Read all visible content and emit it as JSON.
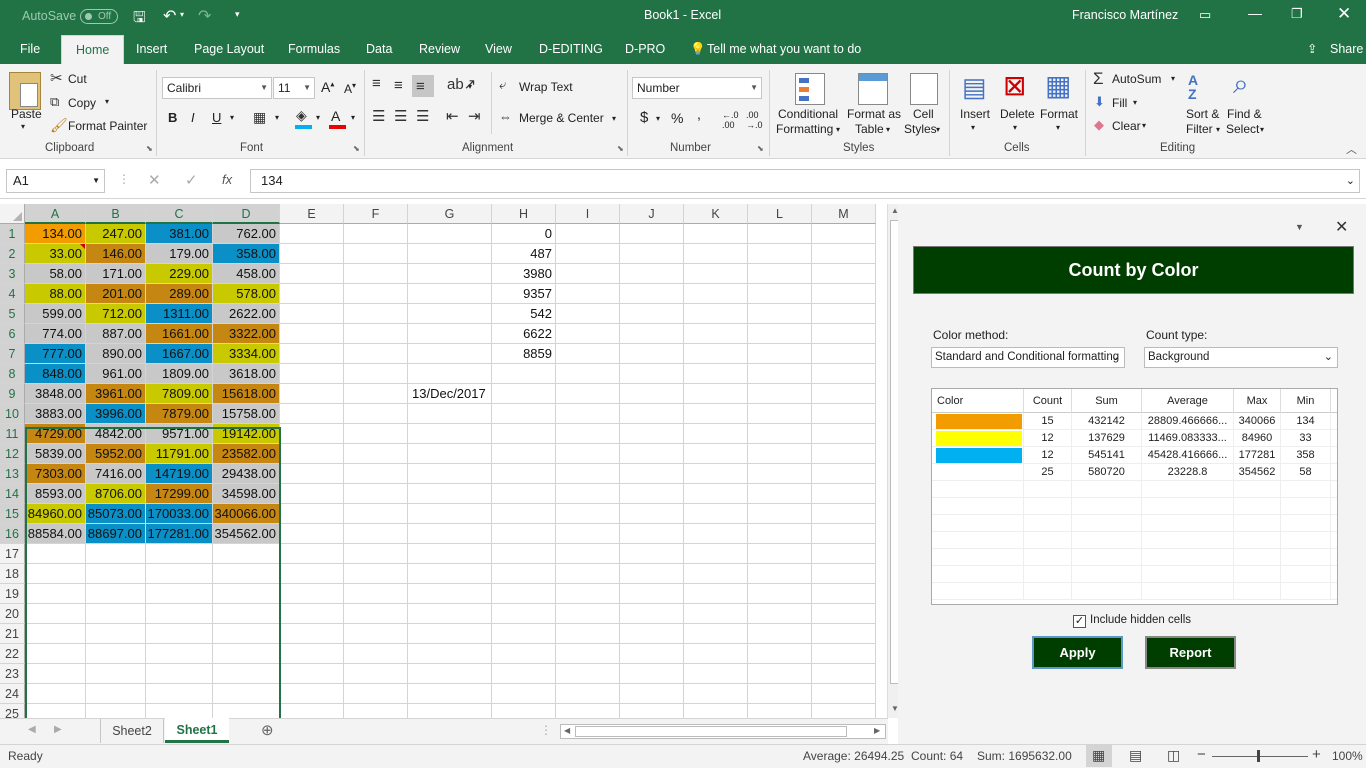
{
  "titlebar": {
    "autosave_label": "AutoSave",
    "autosave_state": "Off",
    "title": "Book1  -  Excel",
    "user": "Francisco Martínez"
  },
  "tabs": [
    "File",
    "Home",
    "Insert",
    "Page Layout",
    "Formulas",
    "Data",
    "Review",
    "View",
    "D-EDITING",
    "D-PRO"
  ],
  "tell_me": "Tell me what you want to do",
  "share": "Share",
  "ribbon": {
    "clipboard": {
      "paste": "Paste",
      "cut": "Cut",
      "copy": "Copy",
      "format_painter": "Format Painter",
      "label": "Clipboard"
    },
    "font": {
      "name": "Calibri",
      "size": "11",
      "bold": "B",
      "italic": "I",
      "underline": "U",
      "label": "Font"
    },
    "alignment": {
      "wrap_text": "Wrap Text",
      "merge_center": "Merge & Center",
      "label": "Alignment"
    },
    "number": {
      "format": "Number",
      "currency": "$",
      "percent": "%",
      "comma": ",",
      "label": "Number"
    },
    "styles": {
      "conditional": "Conditional",
      "conditional2": "Formatting",
      "format_as": "Format as",
      "format_as2": "Table",
      "cell": "Cell",
      "cell2": "Styles",
      "label": "Styles"
    },
    "cells": {
      "insert": "Insert",
      "delete": "Delete",
      "format": "Format",
      "label": "Cells"
    },
    "editing": {
      "autosum": "AutoSum",
      "fill": "Fill",
      "clear": "Clear",
      "sort": "Sort &",
      "sort2": "Filter",
      "find": "Find &",
      "find2": "Select",
      "label": "Editing"
    }
  },
  "formula_bar": {
    "name_box": "A1",
    "fx": "fx",
    "value": "134"
  },
  "columns": [
    "A",
    "B",
    "C",
    "D",
    "E",
    "F",
    "G",
    "H",
    "I",
    "J",
    "K",
    "L",
    "M"
  ],
  "rows": [
    "1",
    "2",
    "3",
    "4",
    "5",
    "6",
    "7",
    "8",
    "9",
    "10",
    "11",
    "12",
    "13",
    "14",
    "15",
    "16",
    "17",
    "18",
    "19",
    "20",
    "21",
    "22",
    "23",
    "24",
    "25"
  ],
  "colors": {
    "orange": "#f29c00",
    "yellow": "#c9c900",
    "blue": "#0a8fc6",
    "grey": "#c8c8c8",
    "brown": "#c68612",
    "green": "#217346",
    "panel_dark": "#003e00"
  },
  "table_cells": [
    [
      "134.00",
      "247.00",
      "381.00",
      "762.00"
    ],
    [
      "33.00",
      "146.00",
      "179.00",
      "358.00"
    ],
    [
      "58.00",
      "171.00",
      "229.00",
      "458.00"
    ],
    [
      "88.00",
      "201.00",
      "289.00",
      "578.00"
    ],
    [
      "599.00",
      "712.00",
      "1311.00",
      "2622.00"
    ],
    [
      "774.00",
      "887.00",
      "1661.00",
      "3322.00"
    ],
    [
      "777.00",
      "890.00",
      "1667.00",
      "3334.00"
    ],
    [
      "848.00",
      "961.00",
      "1809.00",
      "3618.00"
    ],
    [
      "3848.00",
      "3961.00",
      "7809.00",
      "15618.00"
    ],
    [
      "3883.00",
      "3996.00",
      "7879.00",
      "15758.00"
    ],
    [
      "4729.00",
      "4842.00",
      "9571.00",
      "19142.00"
    ],
    [
      "5839.00",
      "5952.00",
      "11791.00",
      "23582.00"
    ],
    [
      "7303.00",
      "7416.00",
      "14719.00",
      "29438.00"
    ],
    [
      "8593.00",
      "8706.00",
      "17299.00",
      "34598.00"
    ],
    [
      "84960.00",
      "85073.00",
      "170033.00",
      "340066.00"
    ],
    [
      "88584.00",
      "88697.00",
      "177281.00",
      "354562.00"
    ]
  ],
  "table_fills": [
    [
      "orange",
      "yellow",
      "blue",
      "grey"
    ],
    [
      "yellow",
      "brown",
      "grey",
      "blue"
    ],
    [
      "grey",
      "grey",
      "yellow",
      "grey"
    ],
    [
      "yellow",
      "brown",
      "brown",
      "yellow"
    ],
    [
      "grey",
      "yellow",
      "blue",
      "grey"
    ],
    [
      "grey",
      "grey",
      "brown",
      "brown"
    ],
    [
      "blue",
      "grey",
      "blue",
      "yellow"
    ],
    [
      "blue",
      "grey",
      "grey",
      "grey"
    ],
    [
      "grey",
      "brown",
      "yellow",
      "brown"
    ],
    [
      "grey",
      "blue",
      "brown",
      "grey"
    ],
    [
      "brown",
      "grey",
      "grey",
      "yellow"
    ],
    [
      "grey",
      "brown",
      "yellow",
      "brown"
    ],
    [
      "brown",
      "grey",
      "blue",
      "grey"
    ],
    [
      "grey",
      "yellow",
      "brown",
      "grey"
    ],
    [
      "yellow",
      "blue",
      "blue",
      "brown"
    ],
    [
      "grey",
      "blue",
      "blue",
      "grey"
    ]
  ],
  "h_column": [
    "0",
    "487",
    "3980",
    "9357",
    "542",
    "6622",
    "8859"
  ],
  "g9": "13/Dec/2017",
  "sheets": [
    "Sheet2",
    "Sheet1"
  ],
  "active_sheet": "Sheet1",
  "status": {
    "ready": "Ready",
    "average": "Average: 26494.25",
    "count": "Count: 64",
    "sum": "Sum: 1695632.00",
    "zoom": "100%"
  },
  "panel": {
    "title": "Count by Color",
    "color_method_label": "Color method:",
    "color_method_value": "Standard and Conditional formatting",
    "count_type_label": "Count type:",
    "count_type_value": "Background",
    "table_headers": [
      "Color",
      "Count",
      "Sum",
      "Average",
      "Max",
      "Min"
    ],
    "table_rows": [
      {
        "swatch": "#f29c00",
        "count": "15",
        "sum": "432142",
        "average": "28809.466666...",
        "max": "340066",
        "min": "134"
      },
      {
        "swatch": "#ffff00",
        "count": "12",
        "sum": "137629",
        "average": "11469.083333...",
        "max": "84960",
        "min": "33"
      },
      {
        "swatch": "#00b0f0",
        "count": "12",
        "sum": "545141",
        "average": "45428.416666...",
        "max": "177281",
        "min": "358"
      },
      {
        "swatch": "#ffffff",
        "count": "25",
        "sum": "580720",
        "average": "23228.8",
        "max": "354562",
        "min": "58"
      }
    ],
    "include_hidden": "Include hidden cells",
    "apply": "Apply",
    "report": "Report"
  }
}
